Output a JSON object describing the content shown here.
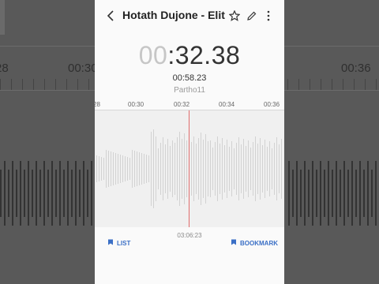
{
  "app": {
    "title": "Hotath Dujone - Elitа...",
    "timer": {
      "dim": "00",
      "bright": ":32.38"
    },
    "total_duration": "00:58.23",
    "source_name": "Partho11",
    "ruler_labels": [
      "28",
      "00:30",
      "00:32",
      "00:34",
      "00:36"
    ],
    "recording_time": "03:06:23",
    "actions": {
      "list_label": "LIST",
      "bookmark_label": "BOOKMARK"
    },
    "icons": {
      "back": "back-arrow-icon",
      "star": "star-icon",
      "edit": "pencil-icon",
      "more": "more-vert-icon",
      "list": "list-icon",
      "bookmark": "bookmark-icon"
    },
    "colors": {
      "accent": "#3a6fc6",
      "playhead": "#e06c6c"
    }
  },
  "background": {
    "time_labels": [
      "28",
      "00:30",
      "00:36"
    ]
  }
}
